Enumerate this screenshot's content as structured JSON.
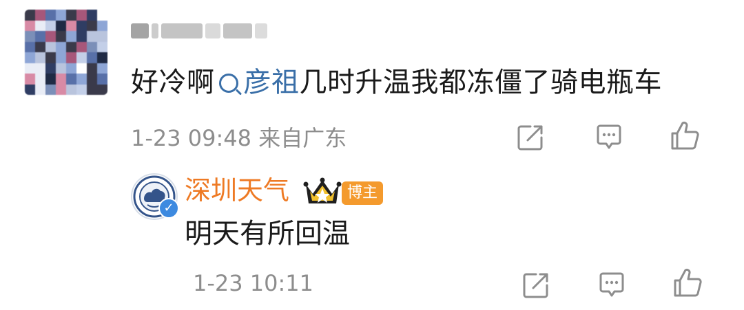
{
  "comment": {
    "text_before": "好冷啊",
    "mention": "彦祖",
    "text_after": "几时升温我都冻僵了骑电瓶车",
    "meta": "1-23 09:48 来自广东"
  },
  "reply": {
    "author": "深圳天气",
    "badge": "博主",
    "text": "明天有所回温",
    "meta": "1-23 10:11"
  },
  "icons": {
    "share": "share-icon",
    "comment": "comment-icon",
    "like": "thumbs-up-icon",
    "search": "search-icon",
    "verified": "verified-check-icon",
    "crown": "crown-icon"
  },
  "colors": {
    "mention": "#3a6fa8",
    "author": "#ee7a24",
    "badge": "#f49a2d",
    "meta": "#8d8d8d",
    "verified": "#3d8ae0"
  }
}
